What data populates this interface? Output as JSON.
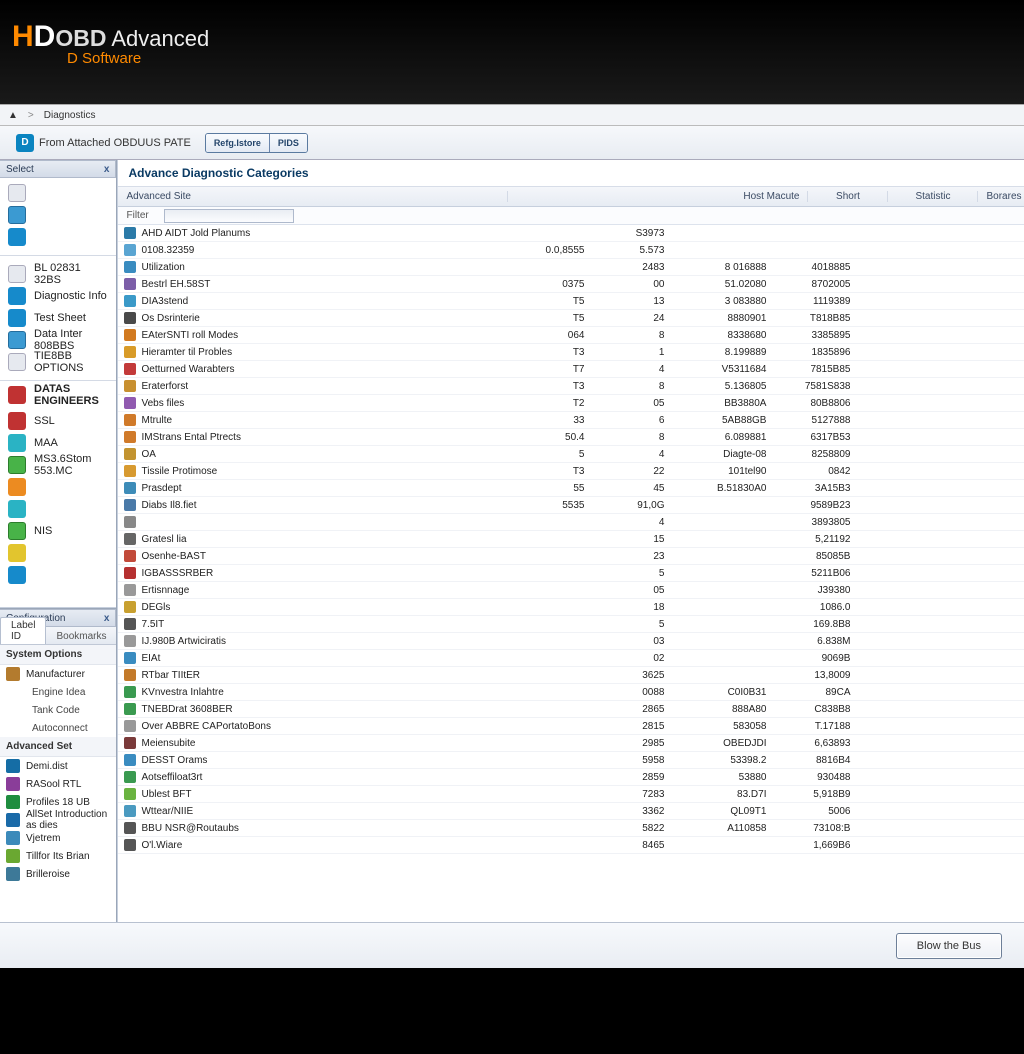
{
  "app": {
    "logo_hd_letter": "H",
    "logo_hd_rest": "D",
    "logo_obd": "OBD",
    "logo_adv": " Advanced",
    "logo_sub": "D Software"
  },
  "breadcrumb": {
    "arrow": ">",
    "item": "Diagnostics"
  },
  "toolbar": {
    "item1": "From Attached OBDUUS PATE",
    "btn1": "Refg.Istore",
    "btn2": "PIDS"
  },
  "sidebar": {
    "panel1": "Select",
    "panel2": "Configuration",
    "close": "x",
    "tabs": {
      "t1": "Label ID",
      "t2": "Bookmarks"
    },
    "cat1": [
      {
        "label": "",
        "ico": "ico-doc"
      },
      {
        "label": "",
        "ico": "ico-sq"
      },
      {
        "label": "",
        "ico": "ico-blue"
      }
    ],
    "cat2": [
      {
        "label": "BL 02831 32BS",
        "ico": "ico-doc"
      },
      {
        "label": "Diagnostic Info",
        "ico": "ico-blue"
      },
      {
        "label": "Test Sheet",
        "ico": "ico-blue"
      },
      {
        "label": "Data Inter 808BBS",
        "ico": "ico-sq"
      },
      {
        "label": "TIE8BB OPTIONS",
        "ico": "ico-doc"
      }
    ],
    "cat3_h": "DATAS  ENGINEERS",
    "cat3": [
      {
        "label": "SSL",
        "ico": "ico-red"
      },
      {
        "label": "MAA",
        "ico": "ico-cy"
      },
      {
        "label": "MS3.6Stom 553.MC",
        "ico": "ico-sqg"
      },
      {
        "label": "",
        "ico": "ico-orn"
      },
      {
        "label": "",
        "ico": "ico-cy"
      },
      {
        "label": "NIS",
        "ico": "ico-sqg"
      },
      {
        "label": "",
        "ico": "ico-yel"
      },
      {
        "label": "",
        "ico": "ico-blue"
      }
    ],
    "cfg_h1": "System Options",
    "cfg1": [
      {
        "label": "Manufacturer",
        "ico": "#b37b2e"
      },
      {
        "label": "Engine Idea",
        "indent": true
      },
      {
        "label": "Tank Code",
        "indent": true
      },
      {
        "label": "Autoconnect",
        "indent": true
      }
    ],
    "cfg_h2": "Advanced Set",
    "cfg2": [
      {
        "label": "Demi.dist",
        "ico": "#156da5"
      },
      {
        "label": "RASool RTL",
        "ico": "#8a3d99"
      },
      {
        "label": "Profiles 18 UB",
        "ico": "#1f8d3f"
      },
      {
        "label": "AllSet Introduction as dies",
        "ico": "#1a6aa8"
      },
      {
        "label": "Vjetrem",
        "ico": "#3c8aba"
      },
      {
        "label": "Tillfor Its Brian",
        "ico": "#6aa831"
      },
      {
        "label": "Brilleroise",
        "ico": "#3d7998"
      }
    ]
  },
  "main": {
    "title": "Advance Diagnostic Categories",
    "cols": {
      "c1": "Advanced Site",
      "c2": "Host Macute",
      "c3": "Short",
      "c4": "Statistic",
      "c5": "Borares"
    },
    "filter_l": "Filter",
    "rows": [
      {
        "n": "AHD AIDT Jold Planums",
        "c2": "",
        "c3": "S3973",
        "c4": "",
        "c5": "",
        "ic": "#2b7aa8"
      },
      {
        "n": "0108.32359",
        "c2": "0.0,8555",
        "c3": "5.573",
        "c4": "",
        "c5": "",
        "ic": "#5aa5d2"
      },
      {
        "n": "Utilization",
        "c2": "",
        "c3": "2483",
        "c4": "8 016888",
        "c5": "4018885",
        "ic": "#3a8cc0"
      },
      {
        "n": "Bestrl EH.58ST",
        "c2": "0375",
        "c3": "00",
        "c4": "51.02080",
        "c5": "8702005",
        "ic": "#7c5ea8"
      },
      {
        "n": "DIA3stend",
        "c2": "T5",
        "c3": "13",
        "c4": "3 083880",
        "c5": "1119389",
        "ic": "#3a99c8"
      },
      {
        "n": "Os Dsrinterie",
        "c2": "T5",
        "c3": "24",
        "c4": "8880901",
        "c5": "T818B85",
        "ic": "#4a4a4a"
      },
      {
        "n": "EAterSNTI roll Modes",
        "c2": "064",
        "c3": "8",
        "c4": "8338680",
        "c5": "3385895",
        "ic": "#d27a20"
      },
      {
        "n": "Hieramter til Probles",
        "c2": "T3",
        "c3": "1",
        "c4": "8.199889",
        "c5": "1835896",
        "ic": "#d89b28"
      },
      {
        "n": "Oetturned Warabters",
        "c2": "T7",
        "c3": "4",
        "c4": "V5311684",
        "c5": "7815B85",
        "ic": "#c33a3a"
      },
      {
        "n": "Eraterforst",
        "c2": "T3",
        "c3": "8",
        "c4": "5.136805",
        "c5": "7581S838",
        "ic": "#c89030"
      },
      {
        "n": "Vebs files",
        "c2": "T2",
        "c3": "05",
        "c4": "BB3880A",
        "c5": "80B8806",
        "ic": "#915ab0"
      },
      {
        "n": "Mtrulte",
        "c2": "33",
        "c3": "6",
        "c4": "5AB88GB",
        "c5": "5127888",
        "ic": "#d07a2a"
      },
      {
        "n": "IMStrans Ental Ptrects",
        "c2": "50.4",
        "c3": "8",
        "c4": "6.089881",
        "c5": "6317B53",
        "ic": "#d07a2a"
      },
      {
        "n": "OA",
        "c2": "5",
        "c3": "4",
        "c4": "Diagte-08",
        "c5": "8258809",
        "ic": "#c39430"
      },
      {
        "n": "Tissile Protimose",
        "c2": "T3",
        "c3": "22",
        "c4": "101tel90",
        "c5": "0842",
        "ic": "#d79a30"
      },
      {
        "n": "Prasdept",
        "c2": "55",
        "c3": "45",
        "c4": "B.51830A0",
        "c5": "3A15B3",
        "ic": "#3d8cb8"
      },
      {
        "n": "Diabs Il8.fiet",
        "c2": "5535",
        "c3": "91,0G",
        "c4": "",
        "c5": "9589B23",
        "ic": "#4a7aa8"
      },
      {
        "n": "",
        "c2": "",
        "c3": "4",
        "c4": "",
        "c5": "3893805",
        "ic": "#888"
      },
      {
        "n": "Gratesl lia",
        "c2": "",
        "c3": "15",
        "c4": "",
        "c5": "5,21192",
        "ic": "#666"
      },
      {
        "n": "Osenhe-BAST",
        "c2": "",
        "c3": "23",
        "c4": "",
        "c5": "85085B",
        "ic": "#c24a3a"
      },
      {
        "n": "IGBASSSRBER",
        "c2": "",
        "c3": "5",
        "c4": "",
        "c5": "5211B06",
        "ic": "#b53030"
      },
      {
        "n": "Ertisnnage",
        "c2": "",
        "c3": "05",
        "c4": "",
        "c5": "J39380",
        "ic": "#999"
      },
      {
        "n": "DEGls",
        "c2": "",
        "c3": "18",
        "c4": "",
        "c5": "1086.0",
        "ic": "#c8a030"
      },
      {
        "n": "7.5IT",
        "c2": "",
        "c3": "5",
        "c4": "",
        "c5": "169.8B8",
        "ic": "#555"
      },
      {
        "n": "IJ.980B Artwiciratis",
        "c2": "",
        "c3": "03",
        "c4": "",
        "c5": "6.838M",
        "ic": "#999"
      },
      {
        "n": "EIAt",
        "c2": "",
        "c3": "02",
        "c4": "",
        "c5": "9069B",
        "ic": "#3a8cc0"
      },
      {
        "n": "RTbar TIItER",
        "c2": "",
        "c3": "3625",
        "c4": "",
        "c5": "13,8009",
        "ic": "#c37a2a"
      },
      {
        "n": "KVnvestra Inlahtre",
        "c2": "",
        "c3": "0088",
        "c4": "C0I0B31",
        "c5": "89CA",
        "ic": "#3a9a50"
      },
      {
        "n": "TNEBDrat 3608BER",
        "c2": "",
        "c3": "2865",
        "c4": "888A80",
        "c5": "C838B8",
        "ic": "#3a9a50"
      },
      {
        "n": "Over ABBRE CAPortatoBons",
        "c2": "",
        "c3": "2815",
        "c4": "583058",
        "c5": "T.17188",
        "ic": "#999"
      },
      {
        "n": "Meiensubite",
        "c2": "",
        "c3": "2985",
        "c4": "OBEDJDI",
        "c5": "6,63893",
        "ic": "#7a3a3a"
      },
      {
        "n": "DESST Orams",
        "c2": "",
        "c3": "5958",
        "c4": "53398.2",
        "c5": "8816B4",
        "ic": "#3a8cc0"
      },
      {
        "n": "Aotseffiloat3rt",
        "c2": "",
        "c3": "2859",
        "c4": "53880",
        "c5": "930488",
        "ic": "#3a9a50"
      },
      {
        "n": "Ublest BFT",
        "c2": "",
        "c3": "7283",
        "c4": "83.D7I",
        "c5": "5,918B9",
        "ic": "#6ab340"
      },
      {
        "n": "Wttear/NIIE",
        "c2": "",
        "c3": "3362",
        "c4": "QL09T1",
        "c5": "5006",
        "ic": "#4a9ac0"
      },
      {
        "n": "BBU NSR@Routaubs",
        "c2": "",
        "c3": "5822",
        "c4": "A110858",
        "c5": "73108:B",
        "ic": "#555"
      },
      {
        "n": "O'l.Wiare",
        "c2": "",
        "c3": "8465",
        "c4": "",
        "c5": "1,669B6",
        "ic": "#555"
      }
    ]
  },
  "footer_btn": "Blow the Bus"
}
